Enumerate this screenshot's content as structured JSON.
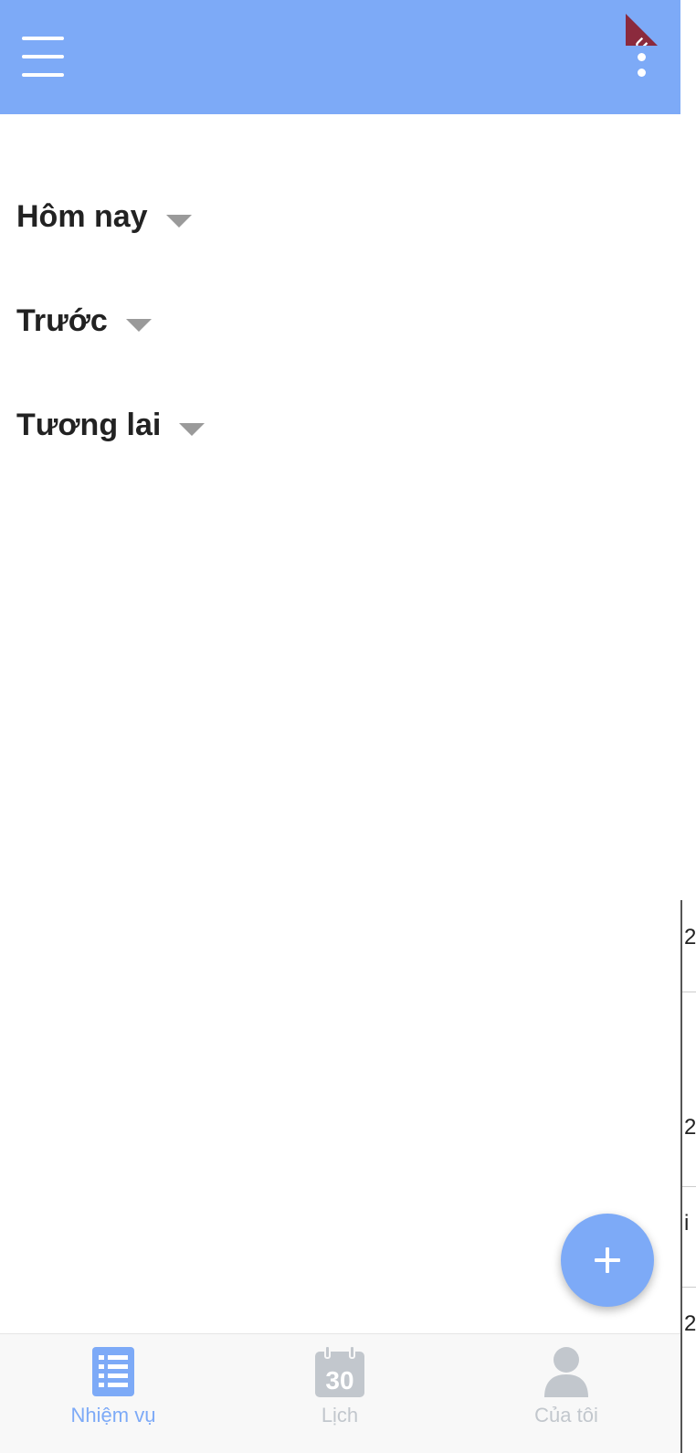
{
  "colors": {
    "primary": "#7daaf7",
    "inactive": "#c2c7cd",
    "text": "#222222",
    "caret": "#9a9a9a",
    "debug_ribbon": "#8b2a3d"
  },
  "appbar": {
    "menu_icon": "hamburger-menu-icon",
    "more_icon": "more-vertical-icon",
    "debug_label": "UG"
  },
  "sections": [
    {
      "label": "Hôm nay",
      "icon": "dropdown-caret-icon"
    },
    {
      "label": "Trước",
      "icon": "dropdown-caret-icon"
    },
    {
      "label": "Tương lai",
      "icon": "dropdown-caret-icon"
    }
  ],
  "fab": {
    "icon": "plus-icon"
  },
  "bottom_nav": {
    "items": [
      {
        "label": "Nhiệm vụ",
        "icon": "task-list-icon",
        "active": true
      },
      {
        "label": "Lịch",
        "icon": "calendar-icon",
        "icon_text": "30",
        "active": false
      },
      {
        "label": "Của tôi",
        "icon": "user-icon",
        "active": false
      }
    ]
  }
}
